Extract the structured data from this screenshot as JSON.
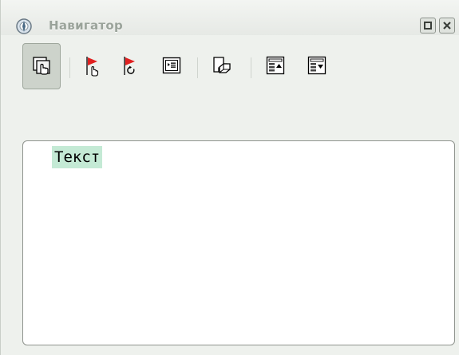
{
  "window": {
    "title": "Навигатор",
    "title_icon": "navigator-compass-icon",
    "buttons": [
      "restore-icon",
      "close-icon"
    ]
  },
  "toolbar": {
    "buttons": [
      {
        "icon": "drag-mode-icon",
        "active": true
      },
      {
        "icon": "previous-object-icon",
        "active": false
      },
      {
        "icon": "next-object-icon",
        "active": false
      },
      {
        "icon": "content-view-icon",
        "active": false
      },
      {
        "icon": "drag-mode-shapes-icon",
        "active": false
      },
      {
        "icon": "promote-level-icon",
        "active": false
      },
      {
        "icon": "demote-level-icon",
        "active": false
      }
    ]
  },
  "tree": {
    "items": [
      {
        "label": "Текст",
        "selected": true
      }
    ]
  },
  "colors": {
    "panel_bg": "#eef1ed",
    "selection": "#c4ead5",
    "flag_red": "#e02020",
    "title_text": "#9aa39a"
  }
}
